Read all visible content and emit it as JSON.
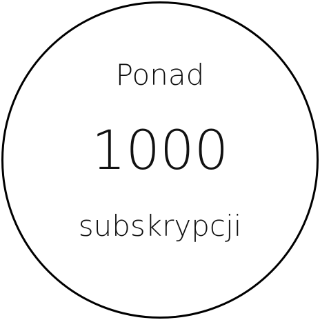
{
  "badge": {
    "prefix": "Ponad",
    "number": "1000",
    "suffix": "subskrypcji"
  },
  "colors": {
    "border": "#000000",
    "text": "#111111",
    "background": "#ffffff"
  }
}
